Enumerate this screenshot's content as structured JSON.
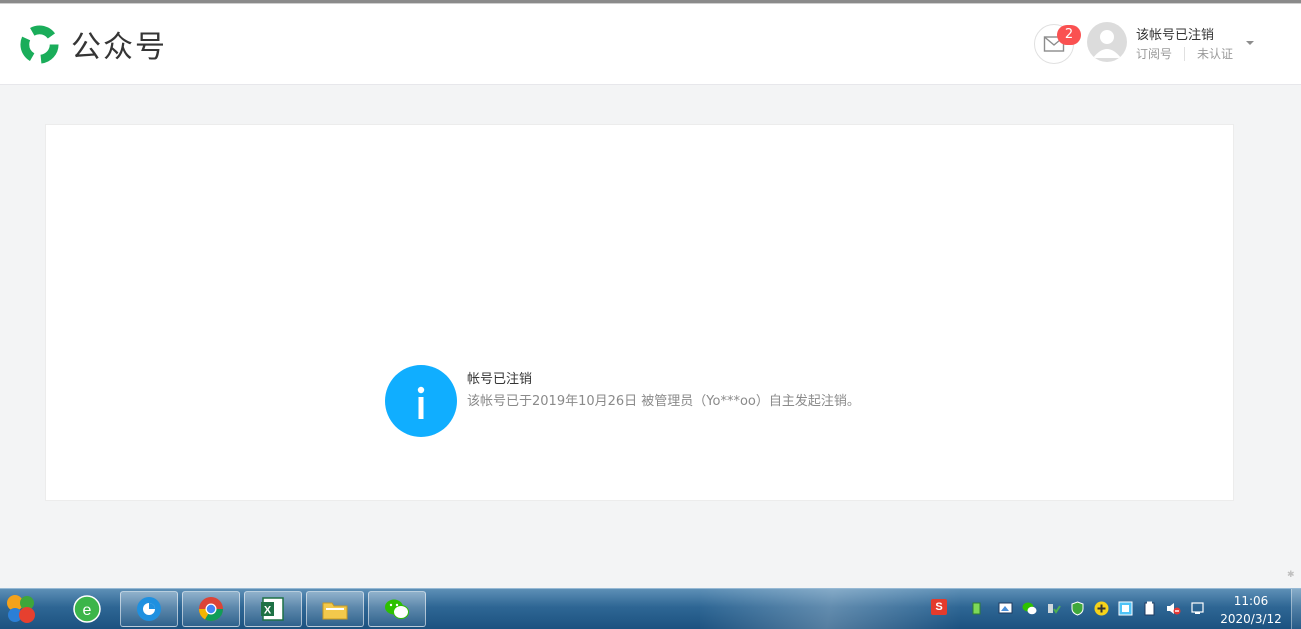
{
  "header": {
    "title": "公众号",
    "notification_count": "2",
    "account_name": "该帐号已注销",
    "account_type": "订阅号",
    "verification": "未认证"
  },
  "notice": {
    "title": "帐号已注销",
    "description": "该帐号已于2019年10月26日  被管理员（Yo***oo）自主发起注销。"
  },
  "taskbar": {
    "time": "11:06",
    "date": "2020/3/12",
    "apps": [
      "360-browser-icon",
      "edge-icon",
      "chrome-icon",
      "excel-icon",
      "file-explorer-icon",
      "wechat-icon"
    ],
    "tray": [
      "sogou-ime-icon",
      "usb-icon",
      "network-icon",
      "wechat-tray-icon",
      "device-icon",
      "security-shield-icon",
      "plus-icon",
      "display-icon",
      "battery-icon",
      "volume-muted-icon",
      "notification-icon"
    ]
  },
  "colors": {
    "brand_green": "#07c160",
    "info_blue": "#10aeff",
    "badge_red": "#fa5151"
  }
}
